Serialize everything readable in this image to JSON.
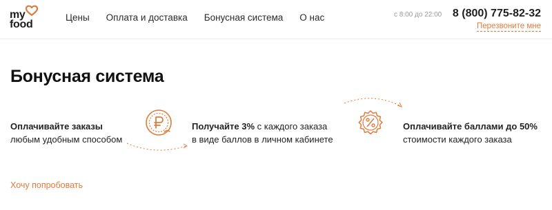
{
  "logo": {
    "line1": "my",
    "line2": "food"
  },
  "nav": {
    "items": [
      "Цены",
      "Оплата и доставка",
      "Бонусная система",
      "О нас"
    ]
  },
  "contact": {
    "hours": "с 8:00 до 22:00",
    "phone": "8 (800) 775-82-32",
    "callback": "Перезвоните мне"
  },
  "page": {
    "title": "Бонусная система"
  },
  "steps": [
    {
      "bold": "Оплачивайте заказы",
      "rest": "",
      "line2": "любым удобным способом"
    },
    {
      "bold": "Получайте 3%",
      "rest": " с каждого заказа",
      "line2": "в виде баллов в личном кабинете"
    },
    {
      "bold": "Оплачивайте баллами до 50%",
      "rest": "",
      "line2": "стоимости каждого заказа"
    }
  ],
  "cta": {
    "label": "Хочу попробовать"
  },
  "colors": {
    "accent": "#e07a3c",
    "text": "#222222"
  },
  "icons": {
    "coin": "ruble-coin-icon",
    "percent": "percent-badge-icon",
    "heart": "heart-icon"
  }
}
